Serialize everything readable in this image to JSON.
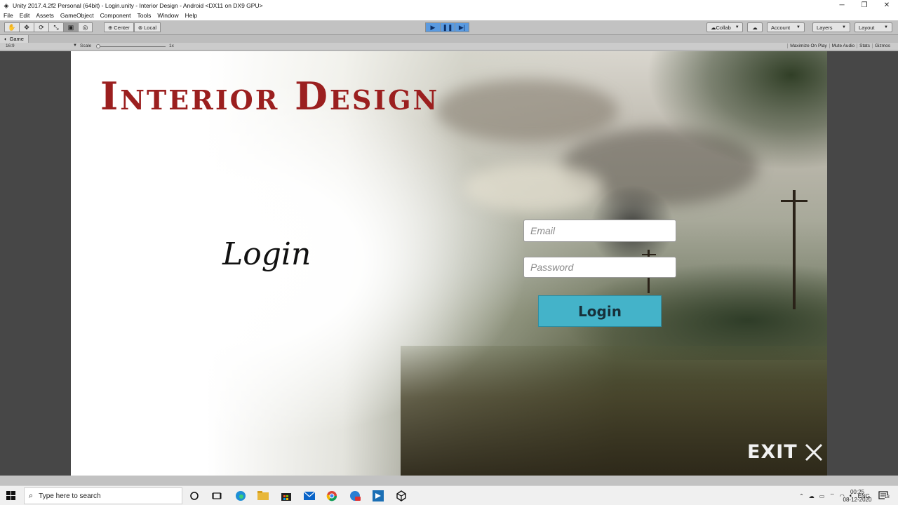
{
  "window": {
    "title": "Unity 2017.4.2f2 Personal (64bit) - Login.unity - Interior Design - Android <DX11 on DX9 GPU>",
    "minimize": "─",
    "restore": "❐",
    "close": "✕"
  },
  "menu": [
    "File",
    "Edit",
    "Assets",
    "GameObject",
    "Component",
    "Tools",
    "Window",
    "Help"
  ],
  "toolbar": {
    "pivot": "Center",
    "space": "Local",
    "collab": "Collab",
    "account": "Account",
    "layers": "Layers",
    "layout": "Layout"
  },
  "game_view": {
    "tab": "Game",
    "aspect": "16:9",
    "scale_label": "Scale",
    "scale_value": "1x",
    "options": [
      "Maximize On Play",
      "Mute Audio",
      "Stats",
      "Gizmos"
    ]
  },
  "scene": {
    "title": "Interior Design",
    "login_heading": "Login",
    "email_placeholder": "Email",
    "password_placeholder": "Password",
    "login_button": "Login",
    "exit_label": "EXIT"
  },
  "taskbar": {
    "search_placeholder": "Type here to search",
    "language": "ENG",
    "time": "00:25",
    "date": "08-12-2020",
    "notification_count": "18"
  },
  "colors": {
    "title_red": "#9b1f1f",
    "login_button": "#44b3c9",
    "play_active": "#5a9ae0"
  }
}
